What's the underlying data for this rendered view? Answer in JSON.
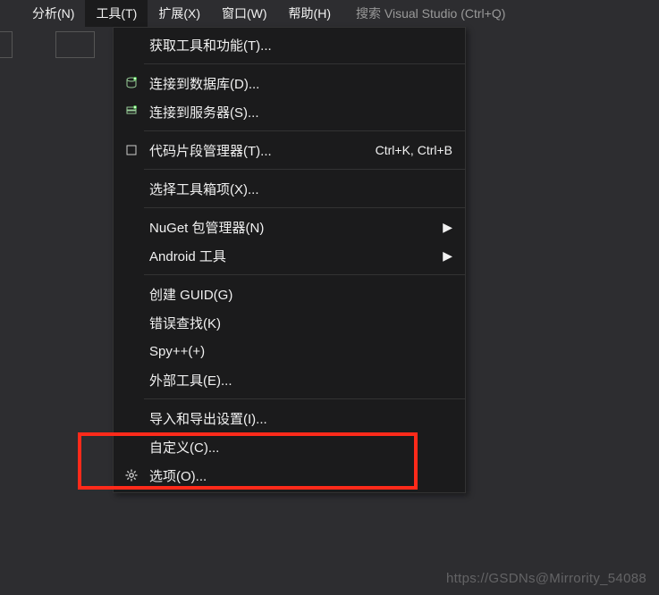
{
  "menubar": {
    "items": [
      {
        "label": "分析(N)"
      },
      {
        "label": "工具(T)"
      },
      {
        "label": "扩展(X)"
      },
      {
        "label": "窗口(W)"
      },
      {
        "label": "帮助(H)"
      }
    ],
    "search_placeholder": "搜索 Visual Studio (Ctrl+Q)"
  },
  "dropdown": {
    "sections": [
      [
        {
          "icon": "",
          "label": "获取工具和功能(T)...",
          "shortcut": "",
          "submenu": false
        }
      ],
      [
        {
          "icon": "database",
          "label": "连接到数据库(D)...",
          "shortcut": "",
          "submenu": false
        },
        {
          "icon": "server",
          "label": "连接到服务器(S)...",
          "shortcut": "",
          "submenu": false
        }
      ],
      [
        {
          "icon": "snippet",
          "label": "代码片段管理器(T)...",
          "shortcut": "Ctrl+K, Ctrl+B",
          "submenu": false
        }
      ],
      [
        {
          "icon": "",
          "label": "选择工具箱项(X)...",
          "shortcut": "",
          "submenu": false
        }
      ],
      [
        {
          "icon": "",
          "label": "NuGet 包管理器(N)",
          "shortcut": "",
          "submenu": true
        },
        {
          "icon": "",
          "label": "Android 工具",
          "shortcut": "",
          "submenu": true
        }
      ],
      [
        {
          "icon": "",
          "label": "创建 GUID(G)",
          "shortcut": "",
          "submenu": false
        },
        {
          "icon": "",
          "label": "错误查找(K)",
          "shortcut": "",
          "submenu": false
        },
        {
          "icon": "",
          "label": "Spy++(+)",
          "shortcut": "",
          "submenu": false
        },
        {
          "icon": "",
          "label": "外部工具(E)...",
          "shortcut": "",
          "submenu": false
        }
      ],
      [
        {
          "icon": "",
          "label": "导入和导出设置(I)...",
          "shortcut": "",
          "submenu": false
        },
        {
          "icon": "",
          "label": "自定义(C)...",
          "shortcut": "",
          "submenu": false
        },
        {
          "icon": "gear",
          "label": "选项(O)...",
          "shortcut": "",
          "submenu": false
        }
      ]
    ]
  },
  "watermark": "https://GSDNs@Mirrority_54088",
  "icons": {
    "arrow": "▶"
  }
}
